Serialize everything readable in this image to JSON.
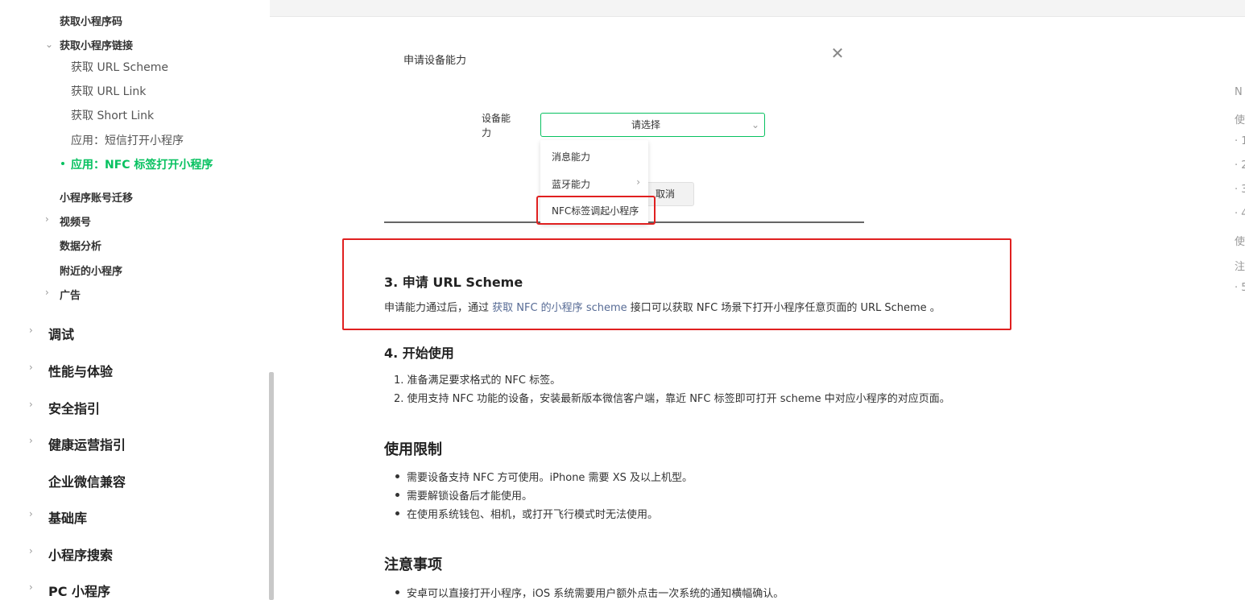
{
  "sidebar": {
    "items": [
      {
        "label": "获取小程序码"
      },
      {
        "label": "获取小程序链接"
      },
      {
        "label": "获取 URL Scheme"
      },
      {
        "label": "获取 URL Link"
      },
      {
        "label": "获取 Short Link"
      },
      {
        "label": "应用：短信打开小程序"
      },
      {
        "label": "应用：NFC 标签打开小程序"
      },
      {
        "label": "小程序账号迁移"
      },
      {
        "label": "视频号"
      },
      {
        "label": "数据分析"
      },
      {
        "label": "附近的小程序"
      },
      {
        "label": "广告"
      },
      {
        "label": "调试"
      },
      {
        "label": "性能与体验"
      },
      {
        "label": "安全指引"
      },
      {
        "label": "健康运营指引"
      },
      {
        "label": "企业微信兼容"
      },
      {
        "label": "基础库"
      },
      {
        "label": "小程序搜索"
      },
      {
        "label": "PC 小程序"
      }
    ]
  },
  "dialog": {
    "title": "申请设备能力",
    "field_label": "设备能力",
    "select_placeholder": "请选择",
    "options": [
      "消息能力",
      "蓝牙能力",
      "NFC标签调起小程序"
    ],
    "cancel": "取消"
  },
  "content": {
    "step3_title": "3. 申请 URL Scheme",
    "step3_pre": "申请能力通过后，通过 ",
    "step3_link": "获取 NFC 的小程序 scheme",
    "step3_post": " 接口可以获取 NFC 场景下打开小程序任意页面的 URL Scheme 。",
    "step4_title": "4. 开始使用",
    "step4_items": [
      "1. 准备满足要求格式的 NFC 标签。",
      "2. 使用支持 NFC 功能的设备，安装最新版本微信客户端，靠近 NFC 标签即可打开 scheme 中对应小程序的对应页面。"
    ],
    "limits_title": "使用限制",
    "limits_items": [
      "需要设备支持 NFC 方可使用。iPhone 需要 XS 及以上机型。",
      "需要解锁设备后才能使用。",
      "在使用系统钱包、相机，或打开飞行模式时无法使用。"
    ],
    "notes_title": "注意事项",
    "notes_items": [
      "安卓可以直接打开小程序，iOS 系统需要用户额外点击一次系统的通知横幅确认。"
    ]
  },
  "toc": [
    "N",
    "使",
    "· 1",
    "· 2",
    "· 3",
    "· 4",
    "使",
    "注",
    "· 5"
  ],
  "colors": {
    "accent": "#07c160",
    "highlight": "#e02020",
    "link": "#576b95"
  },
  "icons": [
    "chevron-down-icon",
    "chevron-right-icon",
    "close-icon"
  ]
}
